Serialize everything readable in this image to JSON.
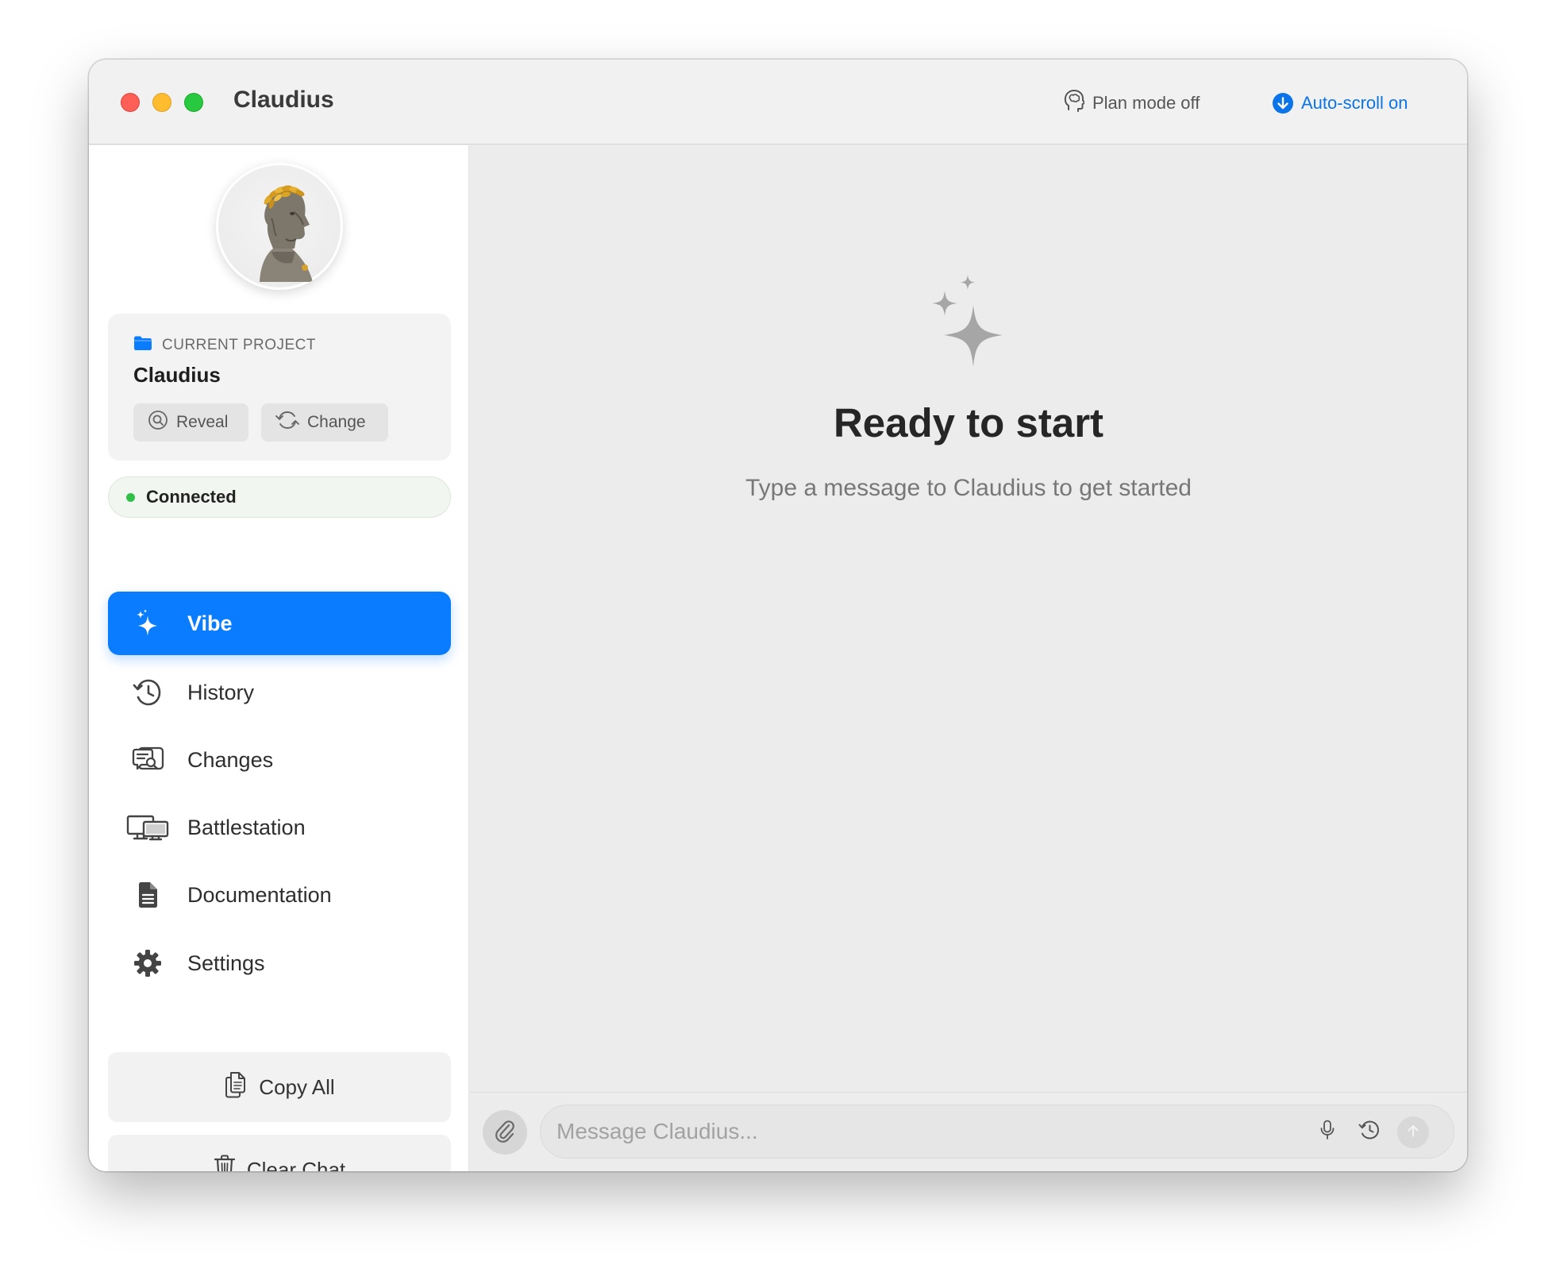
{
  "window": {
    "title": "Claudius",
    "plan_mode_label": "Plan mode off",
    "auto_scroll_label": "Auto-scroll on"
  },
  "sidebar": {
    "project": {
      "label": "CURRENT PROJECT",
      "name": "Claudius",
      "reveal_label": "Reveal",
      "change_label": "Change"
    },
    "status": {
      "label": "Connected",
      "color": "#30c048"
    },
    "nav": [
      {
        "label": "Vibe",
        "icon": "sparkles-icon",
        "active": true
      },
      {
        "label": "History",
        "icon": "history-icon",
        "active": false
      },
      {
        "label": "Changes",
        "icon": "changes-icon",
        "active": false
      },
      {
        "label": "Battlestation",
        "icon": "battlestation-icon",
        "active": false
      },
      {
        "label": "Documentation",
        "icon": "document-icon",
        "active": false
      },
      {
        "label": "Settings",
        "icon": "gear-icon",
        "active": false
      }
    ],
    "copy_all_label": "Copy All",
    "clear_chat_label": "Clear Chat"
  },
  "main": {
    "empty_title": "Ready to start",
    "empty_subtitle": "Type a message to Claudius to get started",
    "composer": {
      "placeholder": "Message Claudius..."
    }
  },
  "colors": {
    "accent": "#0a7cff",
    "link": "#0a74e8",
    "connected": "#30c048"
  }
}
